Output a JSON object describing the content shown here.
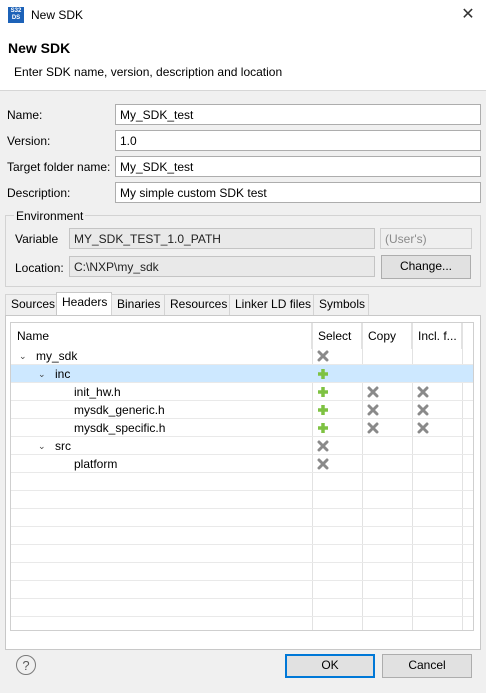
{
  "window": {
    "title": "New SDK",
    "app_icon_text": "S32 DS"
  },
  "header": {
    "title": "New SDK",
    "description": "Enter SDK name, version, description and location"
  },
  "form": {
    "name_label": "Name:",
    "name_value": "My_SDK_test",
    "version_label": "Version:",
    "version_value": "1.0",
    "target_label": "Target folder name:",
    "target_value": "My_SDK_test",
    "description_label": "Description:",
    "description_value": "My simple custom SDK test"
  },
  "environment": {
    "group_title": "Environment",
    "variable_label": "Variable",
    "variable_value": "MY_SDK_TEST_1.0_PATH",
    "scope_value": "(User's)",
    "location_label": "Location:",
    "location_value": "C:\\NXP\\my_sdk",
    "change_button": "Change..."
  },
  "tabs": [
    "Sources",
    "Headers",
    "Binaries",
    "Resources",
    "Linker LD files",
    "Symbols"
  ],
  "active_tab": "Headers",
  "tree": {
    "columns": [
      "Name",
      "Select",
      "Copy",
      "Incl. f..."
    ],
    "rows": [
      {
        "name": "my_sdk",
        "select": "x",
        "copy": "",
        "incl": ""
      },
      {
        "name": "inc",
        "select": "plus",
        "copy": "",
        "incl": ""
      },
      {
        "name": "init_hw.h",
        "select": "plus",
        "copy": "x",
        "incl": "x"
      },
      {
        "name": "mysdk_generic.h",
        "select": "plus",
        "copy": "x",
        "incl": "x"
      },
      {
        "name": "mysdk_specific.h",
        "select": "plus",
        "copy": "x",
        "incl": "x"
      },
      {
        "name": "src",
        "select": "x",
        "copy": "",
        "incl": ""
      },
      {
        "name": "platform",
        "select": "x",
        "copy": "",
        "incl": ""
      }
    ]
  },
  "footer": {
    "ok_button": "OK",
    "cancel_button": "Cancel",
    "help_icon": "?"
  },
  "colors": {
    "selection": "#cde8ff",
    "plus_green": "#7ec242",
    "x_gray": "#8a8a8a",
    "default_button_border": "#0078d7"
  }
}
